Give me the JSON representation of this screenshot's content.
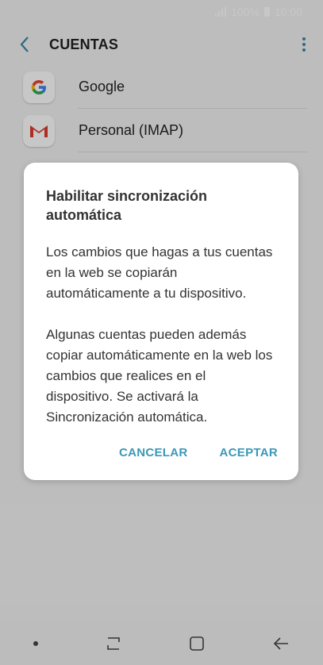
{
  "status_bar": {
    "battery": "100%",
    "time": "10:00"
  },
  "app_bar": {
    "title": "CUENTAS"
  },
  "accounts": [
    {
      "label": "Google",
      "icon": "google-icon"
    },
    {
      "label": "Personal (IMAP)",
      "icon": "gmail-icon"
    }
  ],
  "dialog": {
    "title": "Habilitar sincronización automática",
    "paragraph1": "Los cambios que hagas a tus cuentas en la web se copiarán automáticamente a tu dispositivo.",
    "paragraph2": "Algunas cuentas pueden además copiar automáticamente en la web los cambios que realices en el dispositivo. Se activará la Sincronización automática.",
    "cancel_label": "CANCELAR",
    "accept_label": "ACEPTAR"
  },
  "colors": {
    "accent": "#3a98b8",
    "status_text": "#ffffff"
  }
}
